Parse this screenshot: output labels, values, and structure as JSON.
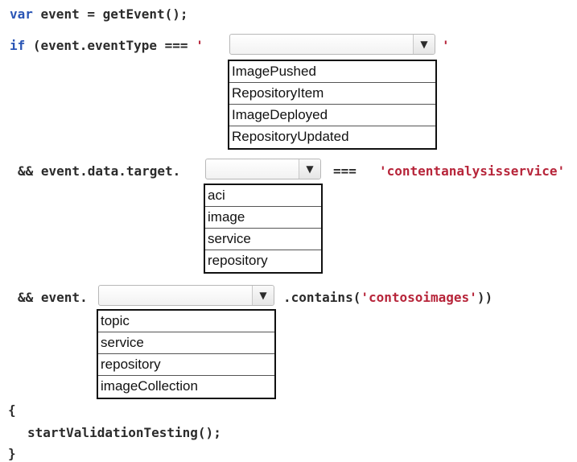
{
  "code": {
    "line1": {
      "kw": "var",
      "rest": " event = getEvent();"
    },
    "line2": {
      "kw": "if",
      "rest": " (event.eventType === ",
      "quote_open": "'",
      "quote_close": "'"
    },
    "line3": {
      "prefix": "&& event.data.target.",
      "op": "===",
      "literal": "'contentanalysisservice'"
    },
    "line4": {
      "prefix": "&& event.",
      "call_open": ".contains(",
      "literal": "'contosoimages'",
      "call_close": "))"
    },
    "open_brace": "{",
    "call": "startValidationTesting();",
    "close_brace": "}"
  },
  "dropdown1": {
    "icon": "chevron-down-icon",
    "glyph": "▼",
    "options": [
      "ImagePushed",
      "RepositoryItem",
      "ImageDeployed",
      "RepositoryUpdated"
    ]
  },
  "dropdown2": {
    "icon": "chevron-down-icon",
    "glyph": "▼",
    "options": [
      "aci",
      "image",
      "service",
      "repository"
    ]
  },
  "dropdown3": {
    "icon": "chevron-down-icon",
    "glyph": "▼",
    "options": [
      "topic",
      "service",
      "repository",
      "imageCollection"
    ]
  },
  "colors": {
    "keyword": "#2a55b5",
    "string": "#b7253a",
    "text": "#2b2b2b"
  }
}
